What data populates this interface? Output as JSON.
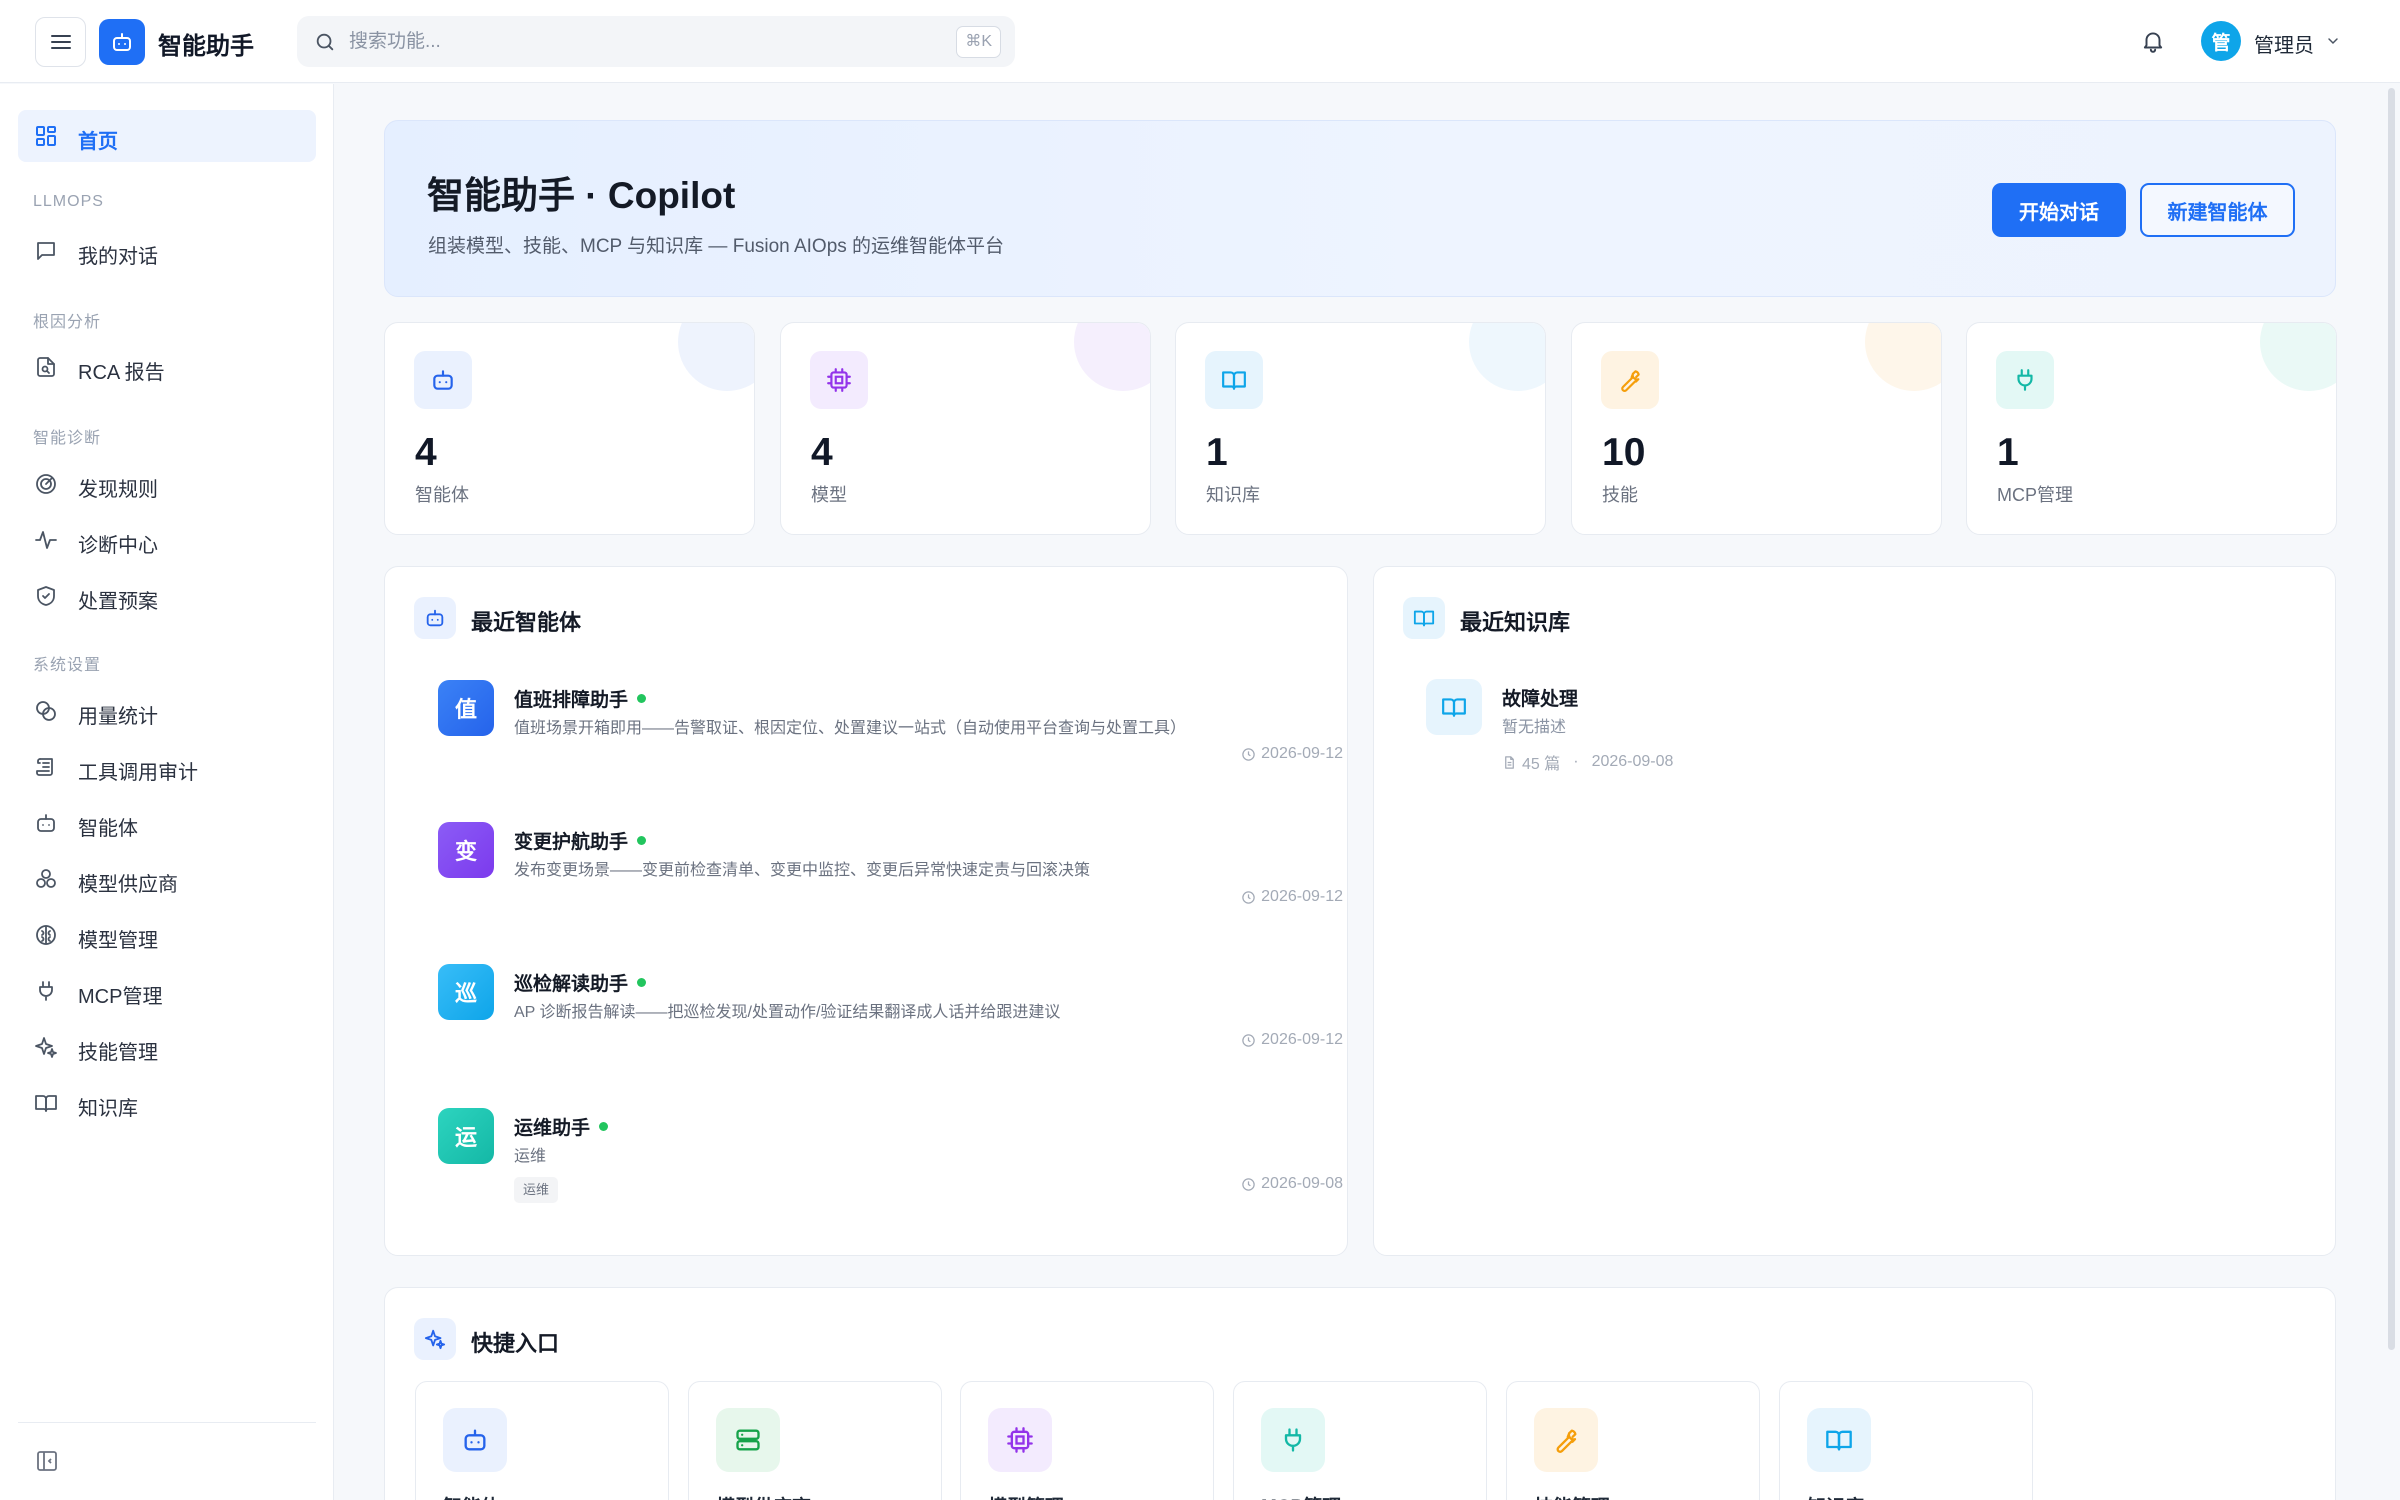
{
  "app": {
    "title": "智能助手",
    "search_placeholder": "搜索功能...",
    "search_shortcut": "⌘K",
    "user_avatar_char": "管",
    "user_name": "管理员",
    "brand_color": "#1f6ff5"
  },
  "sidebar": {
    "home": "首页",
    "groups": [
      "LLMOPS",
      "根因分析",
      "智能诊断",
      "系统设置"
    ],
    "items": [
      {
        "label": "我的对话",
        "icon": "chat-icon"
      },
      {
        "label": "RCA 报告",
        "icon": "report-search-icon"
      },
      {
        "label": "发现规则",
        "icon": "radar-icon"
      },
      {
        "label": "诊断中心",
        "icon": "pulse-icon"
      },
      {
        "label": "处置预案",
        "icon": "shield-check-icon"
      },
      {
        "label": "用量统计",
        "icon": "coins-icon"
      },
      {
        "label": "工具调用审计",
        "icon": "scroll-icon"
      },
      {
        "label": "智能体",
        "icon": "bot-icon"
      },
      {
        "label": "模型供应商",
        "icon": "boxes-icon"
      },
      {
        "label": "模型管理",
        "icon": "brain-icon"
      },
      {
        "label": "MCP管理",
        "icon": "plug-icon"
      },
      {
        "label": "技能管理",
        "icon": "sparkles-icon"
      },
      {
        "label": "知识库",
        "icon": "book-icon"
      }
    ]
  },
  "hero": {
    "title": "智能助手 · Copilot",
    "subtitle": "组装模型、技能、MCP 与知识库 — Fusion AIOps 的运维智能体平台",
    "primary_button": "开始对话",
    "secondary_button": "新建智能体"
  },
  "stats": [
    {
      "value": "4",
      "label": "智能体",
      "icon": "bot-icon",
      "color": "#2563eb",
      "bg": "#eaf1fe"
    },
    {
      "value": "4",
      "label": "模型",
      "icon": "cpu-icon",
      "color": "#9333ea",
      "bg": "#f3ebfe"
    },
    {
      "value": "1",
      "label": "知识库",
      "icon": "book-icon",
      "color": "#0ea5e9",
      "bg": "#e6f4fd"
    },
    {
      "value": "10",
      "label": "技能",
      "icon": "wrench-icon",
      "color": "#f59e0b",
      "bg": "#fef3e2"
    },
    {
      "value": "1",
      "label": "MCP管理",
      "icon": "plug-icon",
      "color": "#14b8a6",
      "bg": "#e3f8f5"
    }
  ],
  "recent_agents": {
    "title": "最近智能体",
    "items": [
      {
        "avatar": "值",
        "name": "值班排障助手",
        "desc": "值班场景开箱即用——告警取证、根因定位、处置建议一站式（自动使用平台查询与处置工具）",
        "date": "2026-09-12",
        "color": "#2563eb",
        "tag": ""
      },
      {
        "avatar": "变",
        "name": "变更护航助手",
        "desc": "发布变更场景——变更前检查清单、变更中监控、变更后异常快速定责与回滚决策",
        "date": "2026-09-12",
        "color": "#7c3aed",
        "tag": ""
      },
      {
        "avatar": "巡",
        "name": "巡检解读助手",
        "desc": "AP 诊断报告解读——把巡检发现/处置动作/验证结果翻译成人话并给跟进建议",
        "date": "2026-09-12",
        "color": "#0ea5e9",
        "tag": ""
      },
      {
        "avatar": "运",
        "name": "运维助手",
        "desc": "运维",
        "date": "2026-09-08",
        "color": "#14b8a6",
        "tag": "运维"
      }
    ]
  },
  "recent_kb": {
    "title": "最近知识库",
    "items": [
      {
        "name": "故障处理",
        "desc": "暂无描述",
        "docs": "45 篇",
        "date": "2026-09-08"
      }
    ]
  },
  "quick": {
    "title": "快捷入口",
    "items": [
      {
        "label": "智能体",
        "icon": "bot-icon",
        "color": "#2563eb",
        "bg": "#eaf1fe"
      },
      {
        "label": "模型供应商",
        "icon": "server-icon",
        "color": "#16a34a",
        "bg": "#e7f7ec"
      },
      {
        "label": "模型管理",
        "icon": "cpu-icon",
        "color": "#9333ea",
        "bg": "#f3ebfe"
      },
      {
        "label": "MCP管理",
        "icon": "plug-icon",
        "color": "#14b8a6",
        "bg": "#e3f8f5"
      },
      {
        "label": "技能管理",
        "icon": "wrench-icon",
        "color": "#f59e0b",
        "bg": "#fef3e2"
      },
      {
        "label": "知识库",
        "icon": "book-icon",
        "color": "#0ea5e9",
        "bg": "#e6f4fd"
      }
    ]
  }
}
